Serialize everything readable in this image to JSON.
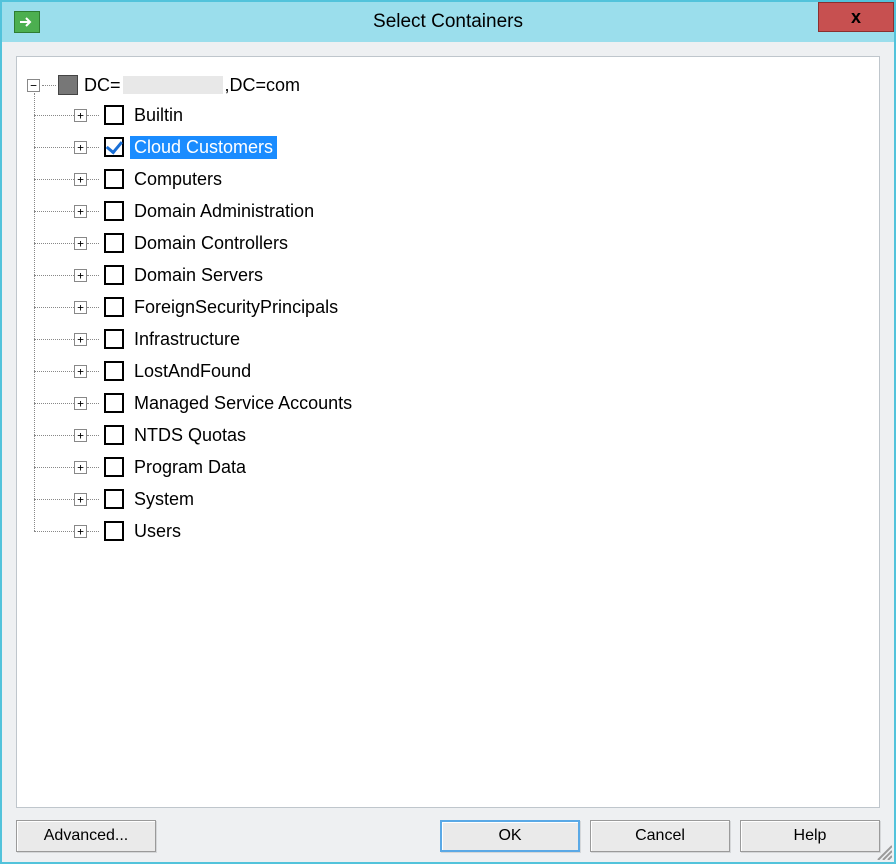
{
  "window": {
    "title": "Select Containers",
    "close_label": "x"
  },
  "tree": {
    "root": {
      "label_prefix": "DC=",
      "label_suffix": ",DC=com",
      "expanded": true,
      "check_state": "indeterminate"
    },
    "children": [
      {
        "label": "Builtin",
        "checked": false,
        "selected": false
      },
      {
        "label": "Cloud Customers",
        "checked": true,
        "selected": true
      },
      {
        "label": "Computers",
        "checked": false,
        "selected": false
      },
      {
        "label": "Domain Administration",
        "checked": false,
        "selected": false
      },
      {
        "label": "Domain Controllers",
        "checked": false,
        "selected": false
      },
      {
        "label": "Domain Servers",
        "checked": false,
        "selected": false
      },
      {
        "label": "ForeignSecurityPrincipals",
        "checked": false,
        "selected": false
      },
      {
        "label": "Infrastructure",
        "checked": false,
        "selected": false
      },
      {
        "label": "LostAndFound",
        "checked": false,
        "selected": false
      },
      {
        "label": "Managed Service Accounts",
        "checked": false,
        "selected": false
      },
      {
        "label": "NTDS Quotas",
        "checked": false,
        "selected": false
      },
      {
        "label": "Program Data",
        "checked": false,
        "selected": false
      },
      {
        "label": "System",
        "checked": false,
        "selected": false
      },
      {
        "label": "Users",
        "checked": false,
        "selected": false
      }
    ]
  },
  "buttons": {
    "advanced": "Advanced...",
    "ok": "OK",
    "cancel": "Cancel",
    "help": "Help"
  },
  "glyphs": {
    "expand": "+",
    "collapse": "−"
  }
}
